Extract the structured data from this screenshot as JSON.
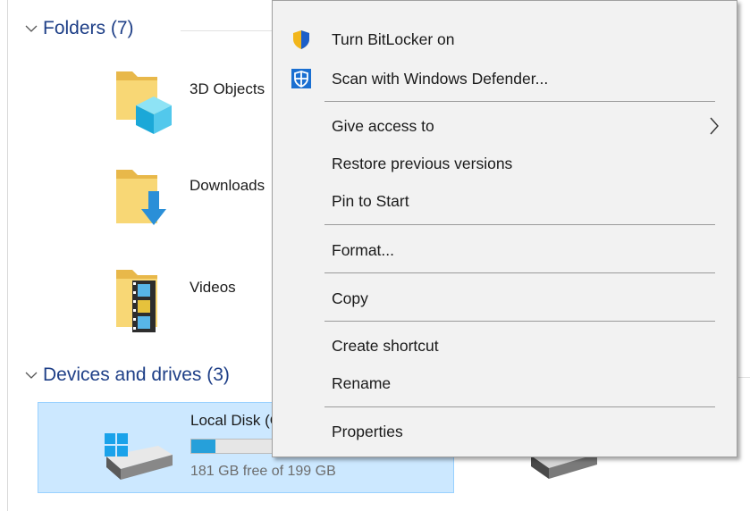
{
  "explorer": {
    "folders_header": "Folders (7)",
    "folders": [
      {
        "label": "3D Objects",
        "icon": "3d-objects-folder-icon"
      },
      {
        "label": "Downloads",
        "icon": "downloads-folder-icon"
      },
      {
        "label": "Videos",
        "icon": "videos-folder-icon"
      }
    ],
    "devices_header": "Devices and drives (3)",
    "drive": {
      "name": "Local Disk (C:)",
      "free_text": "181 GB free of 199 GB",
      "used_fraction": 0.09,
      "icon": "windows-drive-icon"
    },
    "dvd_icon": "dvd-drive-icon",
    "side_text": ")"
  },
  "context_menu": {
    "items": [
      {
        "label": "Turn BitLocker on",
        "icon": "bitlocker-shield-icon"
      },
      {
        "label": "Scan with Windows Defender...",
        "icon": "windows-defender-icon"
      },
      {
        "label": "Give access to",
        "submenu": true
      },
      {
        "label": "Restore previous versions"
      },
      {
        "label": "Pin to Start"
      },
      {
        "label": "Format..."
      },
      {
        "label": "Copy"
      },
      {
        "label": "Create shortcut"
      },
      {
        "label": "Rename"
      },
      {
        "label": "Properties"
      }
    ]
  },
  "colors": {
    "accent": "#26a0da",
    "selection": "#cce8ff",
    "group_header": "#1e3f87",
    "menu_bg": "#f2f2f2"
  }
}
